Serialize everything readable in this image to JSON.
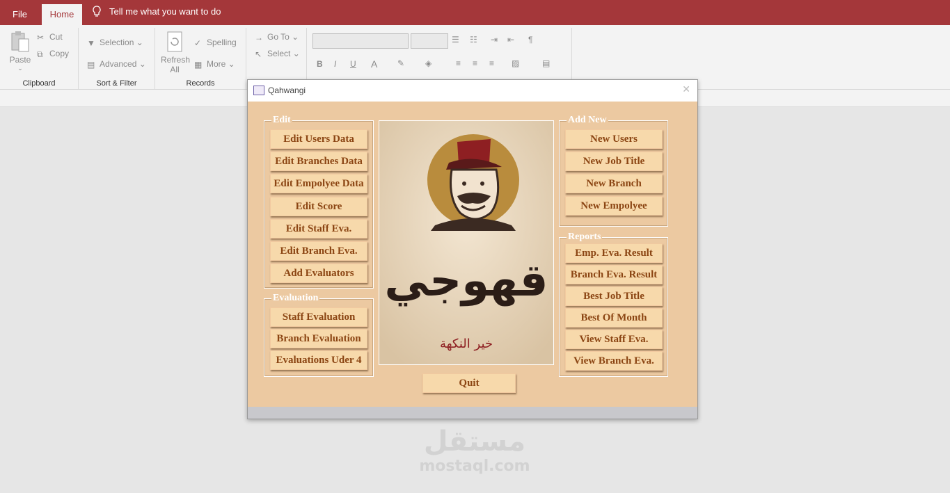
{
  "ribbon": {
    "tabs": {
      "file": "File",
      "home": "Home"
    },
    "tell_me": "Tell me what you want to do",
    "clipboard": {
      "paste": "Paste",
      "cut": "Cut",
      "copy": "Copy",
      "label": "Clipboard"
    },
    "sort_filter": {
      "selection": "Selection",
      "advanced": "Advanced",
      "label": "Sort & Filter"
    },
    "records": {
      "refresh": "Refresh",
      "refresh_sub": "All",
      "spelling": "Spelling",
      "more": "More",
      "label": "Records"
    },
    "find": {
      "goto": "Go To",
      "select": "Select"
    },
    "format": {
      "bold": "B",
      "italic": "I",
      "underline": "U",
      "font_color": "A"
    }
  },
  "form": {
    "title": "Qahwangi",
    "edit": {
      "legend": "Edit",
      "buttons": [
        "Edit Users Data",
        "Edit Branches Data",
        "Edit Empolyee Data",
        "Edit Score",
        "Edit Staff Eva.",
        "Edit Branch Eva.",
        "Add Evaluators"
      ]
    },
    "evaluation": {
      "legend": "Evaluation",
      "buttons": [
        "Staff Evaluation",
        "Branch Evaluation",
        "Evaluations Uder 4"
      ]
    },
    "add_new": {
      "legend": "Add New",
      "buttons": [
        "New Users",
        "New Job Title",
        "New Branch",
        "New Empolyee"
      ]
    },
    "reports": {
      "legend": "Reports",
      "buttons": [
        "Emp. Eva. Result",
        "Branch Eva. Result",
        "Best Job Title",
        "Best Of Month",
        "View Staff Eva.",
        "View Branch Eva."
      ]
    },
    "quit": "Quit",
    "logo": {
      "arabic_title": "قهوجي",
      "arabic_slogan": "خير النكهة"
    }
  },
  "watermark": {
    "arabic": "مستقل",
    "latin": "mostaql.com"
  },
  "colors": {
    "title_bar": "#a4373a",
    "form_bg": "#ecc9a1",
    "button_bg": "#f7d9ab",
    "button_text": "#8b4513"
  }
}
